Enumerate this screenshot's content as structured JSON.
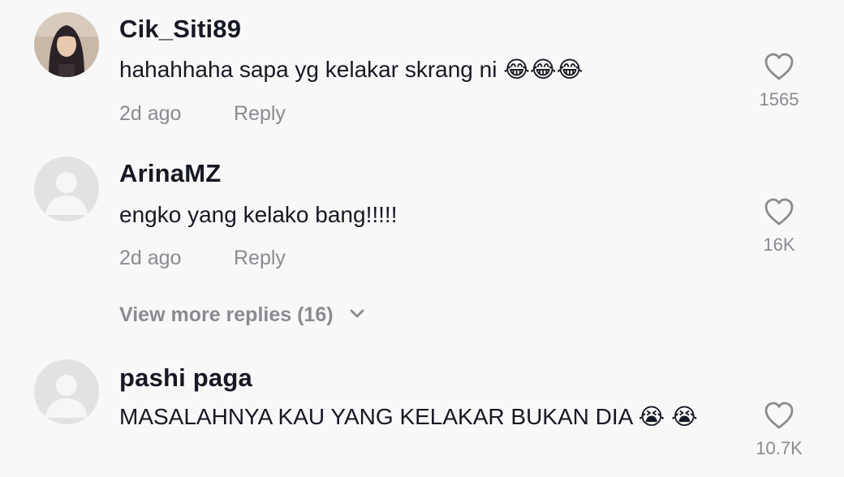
{
  "colors": {
    "background": "#f8f8f8",
    "username": "#161823",
    "muted": "#8a8b91",
    "heart_outline": "#8a8b91"
  },
  "comments": [
    {
      "username": "Cik_Siti89",
      "text": "hahahhaha sapa yg kelakar skrang ni 😂😂😂",
      "time": "2d ago",
      "reply_label": "Reply",
      "likes": "1565",
      "avatar": "photo-avatar"
    },
    {
      "username": "ArinaMZ",
      "text": "engko yang kelako bang!!!!!",
      "time": "2d ago",
      "reply_label": "Reply",
      "likes": "16K",
      "avatar": "default-avatar"
    },
    {
      "username": "pashi paga",
      "text": "MASALAHNYA KAU YANG KELAKAR BUKAN DIA 😭 😭",
      "likes": "10.7K",
      "avatar": "default-avatar"
    }
  ],
  "view_more": {
    "label": "View more replies (16)",
    "icon": "chevron-down-icon"
  }
}
